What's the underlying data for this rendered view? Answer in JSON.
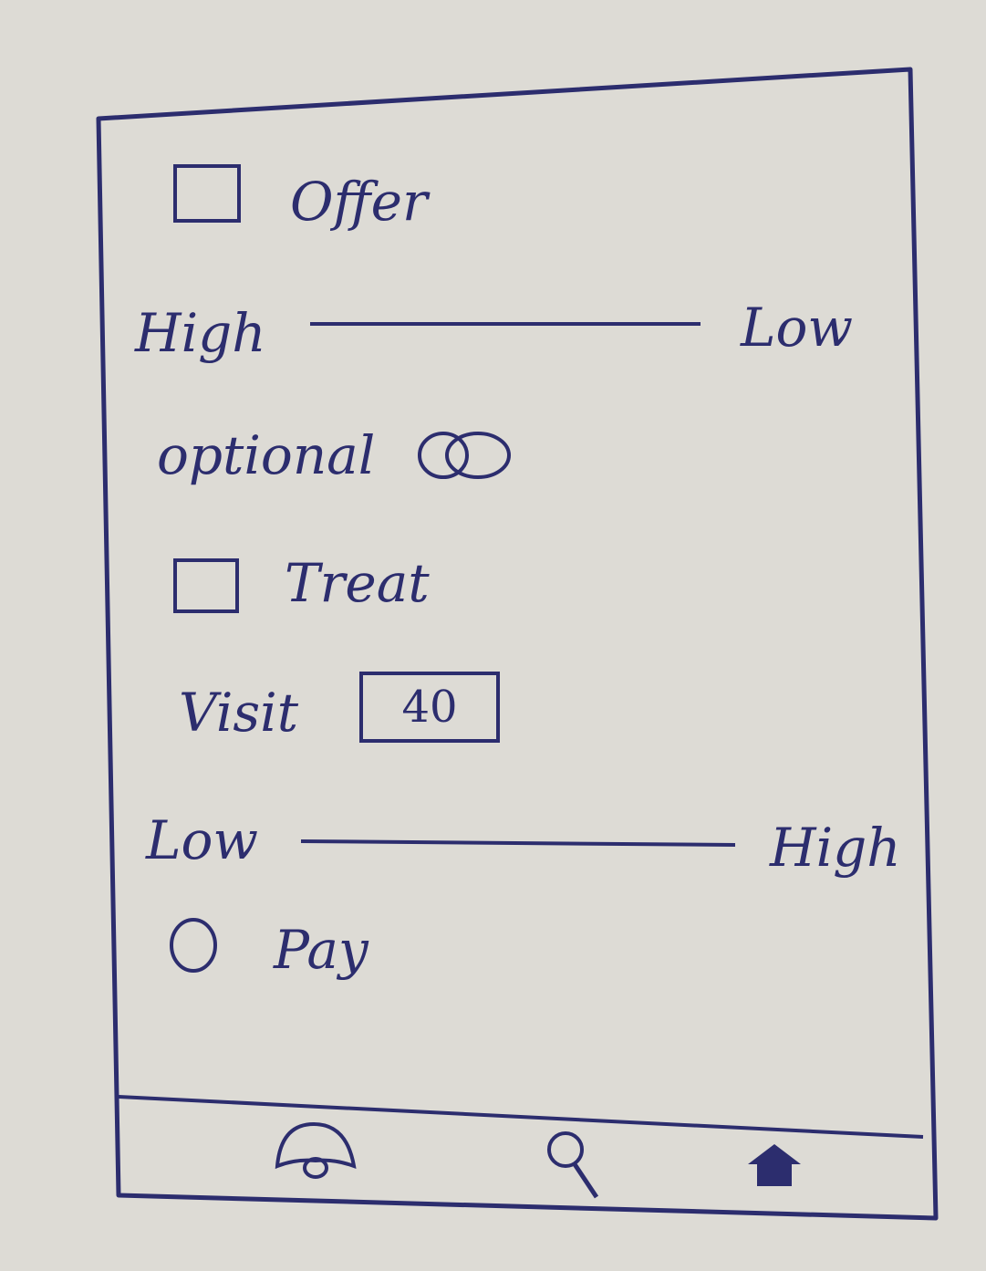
{
  "filters": {
    "offer_label": "Offer",
    "slider1": {
      "left_label": "High",
      "right_label": "Low"
    },
    "optional_label": "optional",
    "treat_label": "Treat",
    "visit_label": "Visit",
    "visit_value": "40",
    "slider2": {
      "left_label": "Low",
      "right_label": "High"
    },
    "pay_label": "Pay"
  },
  "nav": {
    "icons": [
      "bell-icon",
      "search-icon",
      "home-icon"
    ]
  },
  "colors": {
    "ink": "#2c2d6e",
    "paper": "#dddbd5"
  }
}
